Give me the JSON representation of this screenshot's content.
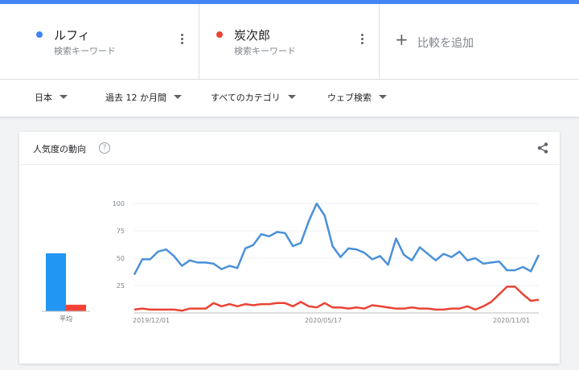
{
  "terms": [
    {
      "name": "ルフィ",
      "type": "検索キーワード",
      "color": "#4285f4"
    },
    {
      "name": "炭次郎",
      "type": "検索キーワード",
      "color": "#ea4335"
    }
  ],
  "add_term": {
    "icon": "plus-icon",
    "label": "比較を追加"
  },
  "filters": {
    "region": "日本",
    "period": "過去 12 か月間",
    "category": "すべてのカテゴリ",
    "search_type": "ウェブ検索"
  },
  "card": {
    "title": "人気度の動向",
    "help_icon": "help-icon",
    "help_symbol": "?",
    "share_icon": "share-icon"
  },
  "chart_data": {
    "type": "line",
    "x_ticks": [
      "2019/12/01",
      "2020/05/17",
      "2020/11/01"
    ],
    "y_ticks": [
      "100",
      "75",
      "50",
      "25"
    ],
    "ylim": [
      0,
      100
    ],
    "grid": true,
    "average_label": "平均",
    "averages": [
      53,
      6
    ],
    "series": [
      {
        "name": "ルフィ",
        "color": "#4a90d9",
        "values": [
          35,
          49,
          49,
          56,
          58,
          52,
          43,
          48,
          46,
          46,
          45,
          40,
          43,
          41,
          59,
          62,
          72,
          70,
          74,
          73,
          61,
          64,
          84,
          100,
          89,
          61,
          51,
          59,
          58,
          55,
          49,
          52,
          44,
          68,
          53,
          48,
          60,
          54,
          48,
          54,
          51,
          56,
          48,
          50,
          45,
          46,
          47,
          39,
          39,
          42,
          38,
          53
        ]
      },
      {
        "name": "炭次郎",
        "color": "#ea4335",
        "values": [
          3,
          4,
          3,
          3,
          3,
          3,
          2,
          4,
          4,
          4,
          9,
          6,
          8,
          6,
          8,
          7,
          8,
          8,
          9,
          9,
          6,
          10,
          6,
          5,
          9,
          5,
          5,
          4,
          5,
          4,
          7,
          6,
          5,
          4,
          4,
          5,
          4,
          4,
          3,
          3,
          4,
          4,
          6,
          3,
          6,
          10,
          17,
          24,
          24,
          17,
          11,
          12
        ]
      }
    ]
  }
}
